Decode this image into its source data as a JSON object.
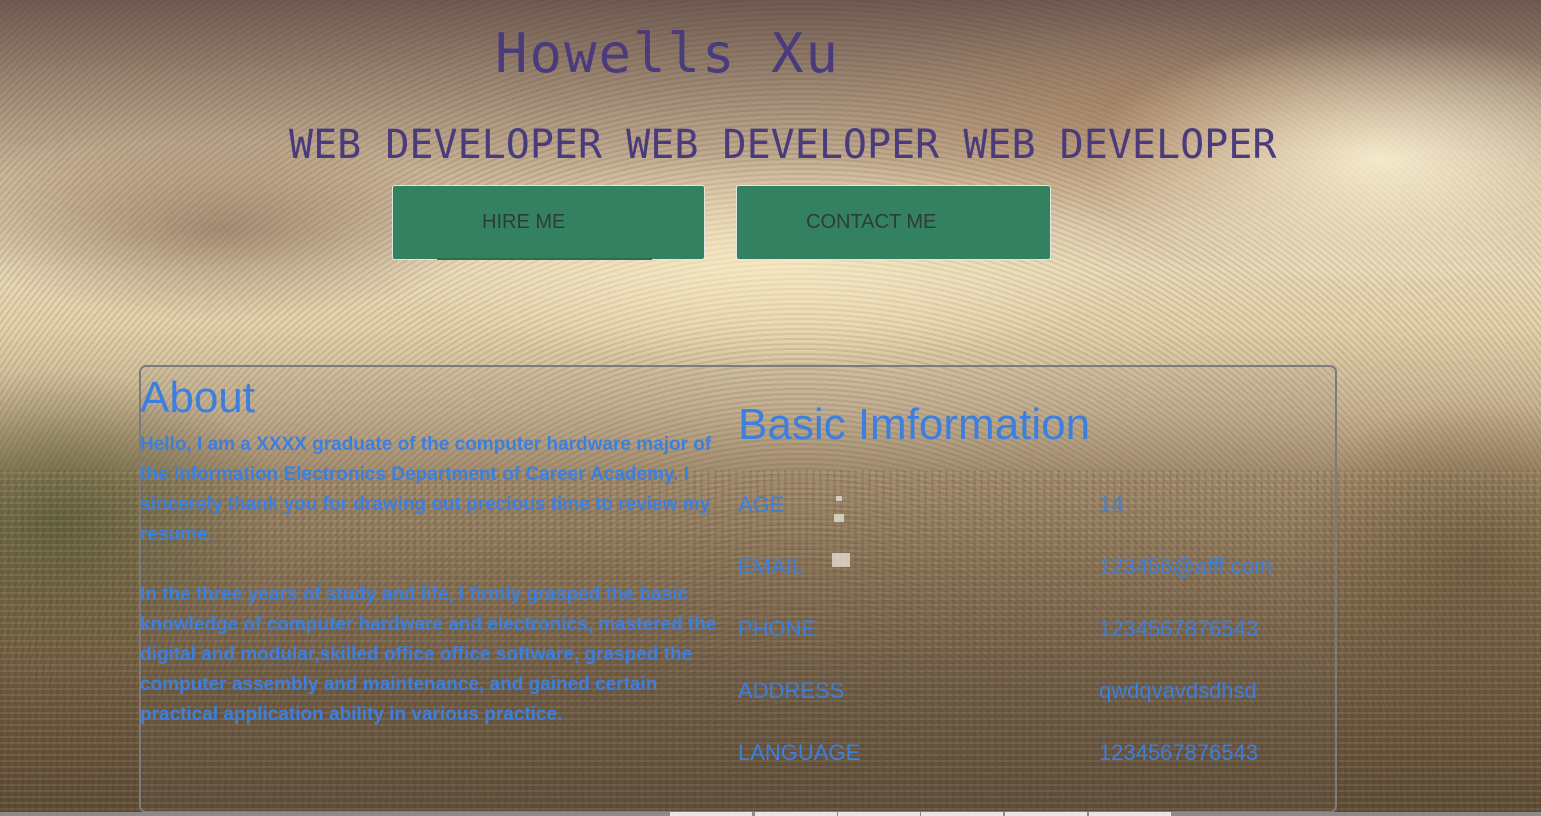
{
  "header": {
    "name": "Howells Xu",
    "roles": [
      "WEB DEVELOPER",
      "WEB DEVELOPER",
      "WEB DEVELOPER"
    ]
  },
  "buttons": {
    "hire": "HIRE ME",
    "contact": "CONTACT ME"
  },
  "about": {
    "title": "About",
    "paragraphs": [
      "Hello, I am a XXXX graduate of the computer hardware major of the Information Electronics Department of Career Academy. I sincerely thank you for drawing out precious time to review my resume.",
      "In the three years of study and life, I firmly grasped the basic knowledge of computer hardware and electronics, mastered the digital and modular,skilled office office software, grasped the computer assembly and maintenance, and gained certain practical application ability in various practice."
    ]
  },
  "basic_info": {
    "title": "Basic Imformation",
    "rows": [
      {
        "label": "AGE",
        "value": "14"
      },
      {
        "label": "EMAIL",
        "value": "123456@afff.com"
      },
      {
        "label": "PHONE",
        "value": "1234567876543"
      },
      {
        "label": "ADDRESS",
        "value": "qwdqvavdsdhsd"
      },
      {
        "label": "LANGUAGE",
        "value": "1234567876543"
      }
    ]
  },
  "colors": {
    "accent_text": "#3d7fdf",
    "title_text": "#4a3b7c",
    "button_bg": "#338160"
  }
}
